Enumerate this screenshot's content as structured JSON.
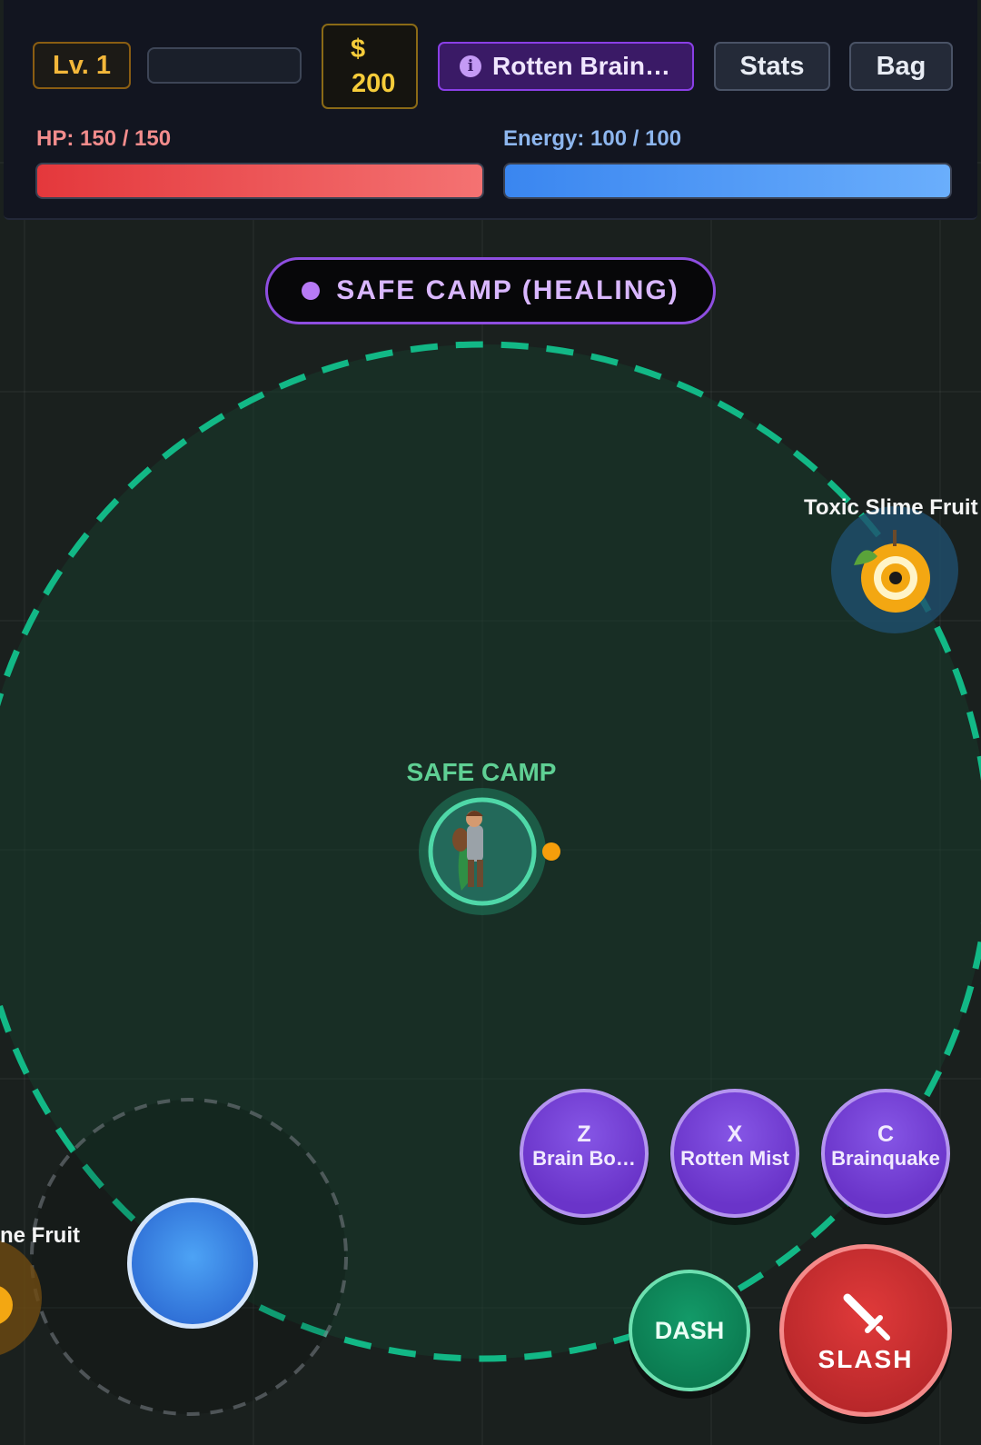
{
  "hud": {
    "level_label": "Lv. 1",
    "xp_progress": 0,
    "currency_symbol": "$",
    "currency_amount": "200",
    "active_skill": "Rotten Brain…",
    "stats_label": "Stats",
    "bag_label": "Bag",
    "hp_label": "HP: 150 / 150",
    "hp_current": 150,
    "hp_max": 150,
    "energy_label": "Energy: 100 / 100",
    "energy_current": 100,
    "energy_max": 100
  },
  "zone": {
    "banner": "SAFE CAMP (HEALING)"
  },
  "world": {
    "camp_label": "SAFE CAMP",
    "enemies": [
      {
        "label": "Toxic Slime Fruit"
      },
      {
        "label": "ne Fruit"
      }
    ]
  },
  "controls": {
    "abilities": [
      {
        "key": "Z",
        "name": "Brain Bo…"
      },
      {
        "key": "X",
        "name": "Rotten Mist"
      },
      {
        "key": "C",
        "name": "Brainquake"
      }
    ],
    "dash_label": "DASH",
    "slash_label": "SLASH"
  },
  "colors": {
    "hp": "#ef4444",
    "energy": "#3b82f6",
    "safe_zone": "#12b886",
    "accent_purple": "#8e4ee0"
  }
}
